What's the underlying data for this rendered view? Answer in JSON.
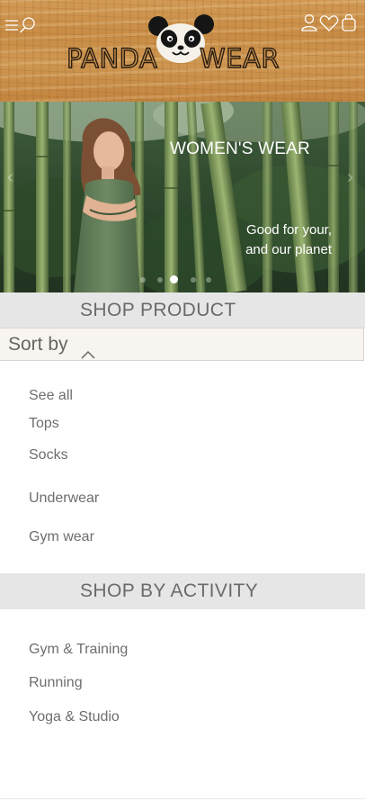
{
  "header": {
    "brand_left": "PANDA",
    "brand_right": "WEAR",
    "icons": {
      "menu": "menu-icon",
      "search": "search-icon",
      "account": "user-icon",
      "wishlist": "heart-icon",
      "bag": "shopping-bag-icon"
    }
  },
  "hero": {
    "title": "WOMEN'S WEAR",
    "subtitle_line1": "Good for your,",
    "subtitle_line2": "and our planet",
    "prev_label": "‹",
    "next_label": "›",
    "slide_index": 2,
    "slide_count": 5
  },
  "shop_product": {
    "title": "SHOP  PRODUCT",
    "sort_label": "Sort by",
    "items": [
      "See all",
      "Tops",
      "Socks",
      "Underwear",
      "Gym wear"
    ]
  },
  "shop_activity": {
    "title": "SHOP BY ACTIVITY",
    "items": [
      "Gym & Training",
      "Running",
      "Yoga & Studio"
    ]
  },
  "colors": {
    "wood": "#c88c45",
    "section_bg": "#e6e6e6",
    "sort_bg": "#f8f4ef",
    "text": "#6e6e6e"
  }
}
